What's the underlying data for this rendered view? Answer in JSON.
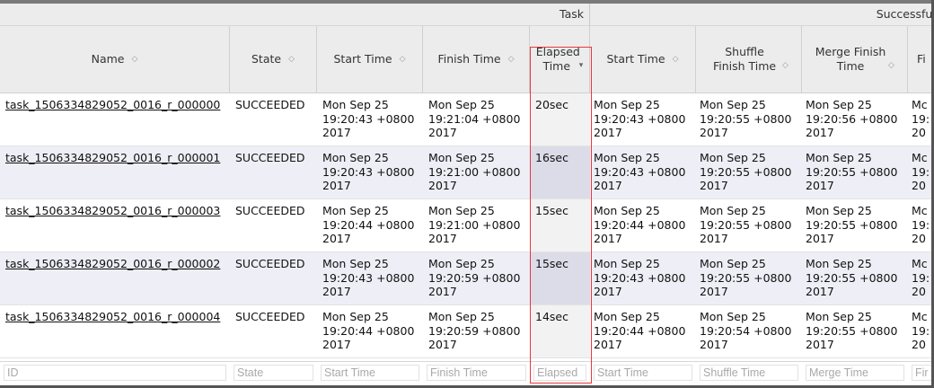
{
  "groups": {
    "task": "Task",
    "successful": "Successful /"
  },
  "columns": [
    {
      "label": "Name",
      "sortable": true
    },
    {
      "label": "State",
      "sortable": true
    },
    {
      "label": "Start Time",
      "sortable": true
    },
    {
      "label": "Finish Time",
      "sortable": true
    },
    {
      "label": "Elapsed Time",
      "sortable": true,
      "sorted": "desc"
    },
    {
      "label": "Start Time",
      "sortable": true
    },
    {
      "label": "Shuffle Finish Time",
      "sortable": true
    },
    {
      "label": "Merge Finish Time",
      "sortable": true
    },
    {
      "label": "Fi",
      "sortable": false
    }
  ],
  "rows": [
    {
      "name": "task_1506334829052_0016_r_000000",
      "state": "SUCCEEDED",
      "start": [
        "Mon Sep 25",
        "19:20:43 +0800",
        "2017"
      ],
      "finish": [
        "Mon Sep 25",
        "19:21:04 +0800",
        "2017"
      ],
      "elapsed": "20sec",
      "s_start": [
        "Mon Sep 25",
        "19:20:43 +0800",
        "2017"
      ],
      "shuffle": [
        "Mon Sep 25",
        "19:20:55 +0800",
        "2017"
      ],
      "merge": [
        "Mon Sep 25",
        "19:20:56 +0800",
        "2017"
      ],
      "fi": [
        "Mc",
        "19:",
        "20"
      ]
    },
    {
      "name": "task_1506334829052_0016_r_000001",
      "state": "SUCCEEDED",
      "start": [
        "Mon Sep 25",
        "19:20:43 +0800",
        "2017"
      ],
      "finish": [
        "Mon Sep 25",
        "19:21:00 +0800",
        "2017"
      ],
      "elapsed": "16sec",
      "s_start": [
        "Mon Sep 25",
        "19:20:43 +0800",
        "2017"
      ],
      "shuffle": [
        "Mon Sep 25",
        "19:20:55 +0800",
        "2017"
      ],
      "merge": [
        "Mon Sep 25",
        "19:20:55 +0800",
        "2017"
      ],
      "fi": [
        "Mc",
        "19:",
        "20"
      ]
    },
    {
      "name": "task_1506334829052_0016_r_000003",
      "state": "SUCCEEDED",
      "start": [
        "Mon Sep 25",
        "19:20:44 +0800",
        "2017"
      ],
      "finish": [
        "Mon Sep 25",
        "19:21:00 +0800",
        "2017"
      ],
      "elapsed": "15sec",
      "s_start": [
        "Mon Sep 25",
        "19:20:44 +0800",
        "2017"
      ],
      "shuffle": [
        "Mon Sep 25",
        "19:20:55 +0800",
        "2017"
      ],
      "merge": [
        "Mon Sep 25",
        "19:20:55 +0800",
        "2017"
      ],
      "fi": [
        "Mc",
        "19:",
        "20"
      ]
    },
    {
      "name": "task_1506334829052_0016_r_000002",
      "state": "SUCCEEDED",
      "start": [
        "Mon Sep 25",
        "19:20:43 +0800",
        "2017"
      ],
      "finish": [
        "Mon Sep 25",
        "19:20:59 +0800",
        "2017"
      ],
      "elapsed": "15sec",
      "s_start": [
        "Mon Sep 25",
        "19:20:43 +0800",
        "2017"
      ],
      "shuffle": [
        "Mon Sep 25",
        "19:20:55 +0800",
        "2017"
      ],
      "merge": [
        "Mon Sep 25",
        "19:20:55 +0800",
        "2017"
      ],
      "fi": [
        "Mc",
        "19:",
        "20"
      ]
    },
    {
      "name": "task_1506334829052_0016_r_000004",
      "state": "SUCCEEDED",
      "start": [
        "Mon Sep 25",
        "19:20:44 +0800",
        "2017"
      ],
      "finish": [
        "Mon Sep 25",
        "19:20:59 +0800",
        "2017"
      ],
      "elapsed": "14sec",
      "s_start": [
        "Mon Sep 25",
        "19:20:44 +0800",
        "2017"
      ],
      "shuffle": [
        "Mon Sep 25",
        "19:20:54 +0800",
        "2017"
      ],
      "merge": [
        "Mon Sep 25",
        "19:20:55 +0800",
        "2017"
      ],
      "fi": [
        "Mc",
        "19:",
        "20"
      ]
    }
  ],
  "filters": [
    "ID",
    "State",
    "Start Time",
    "Finish Time",
    "Elapsed",
    "Start Time",
    "Shuffle Time",
    "Merge Time",
    "Fir"
  ],
  "icons": {
    "sort": "sort-arrows-icon",
    "sorted_desc": "sort-desc-icon"
  },
  "colors": {
    "highlight": "#e8373d",
    "alt_row": "#eeeef6",
    "header_bg": "#ececec"
  }
}
